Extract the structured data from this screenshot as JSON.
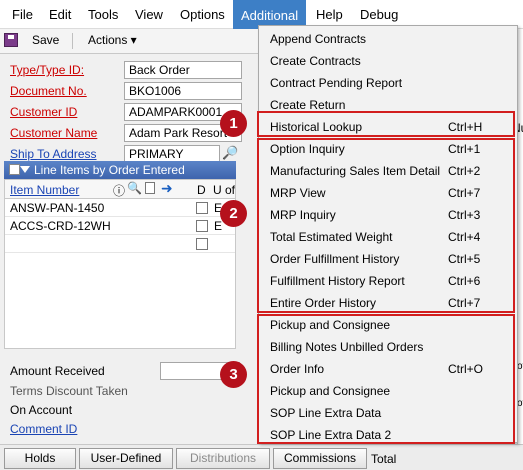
{
  "menubar": [
    "File",
    "Edit",
    "Tools",
    "View",
    "Options",
    "Additional",
    "Help",
    "Debug"
  ],
  "toolbar": {
    "save_label": "Save",
    "actions_label": "Actions ▾"
  },
  "form": {
    "fields": [
      {
        "label": "Type/Type ID:",
        "value": "Back Order"
      },
      {
        "label": "Document No.",
        "value": "BKO1006"
      },
      {
        "label": "Customer ID",
        "value": "ADAMPARK0001"
      },
      {
        "label": "Customer Name",
        "value": "Adam Park Resort"
      },
      {
        "label": "Ship To Address",
        "value": "PRIMARY"
      }
    ]
  },
  "line_items": {
    "header": "Line Items by Order Entered",
    "col_item": "Item Number",
    "col_d": "D",
    "col_u": "U of",
    "rows": [
      {
        "item": "ANSW-PAN-1450",
        "u": "E"
      },
      {
        "item": "ACCS-CRD-12WH",
        "u": "E"
      },
      {
        "item": "",
        "u": ""
      }
    ]
  },
  "bottom_fields": [
    "Amount Received",
    "Terms Discount Taken",
    "On Account",
    "Comment ID"
  ],
  "tabs": [
    "Holds",
    "User-Defined",
    "Distributions",
    "Commissions"
  ],
  "tab_extra": "Total",
  "dropdown": {
    "items": [
      {
        "label": "Append Contracts",
        "shortcut": ""
      },
      {
        "label": "Create Contracts",
        "shortcut": ""
      },
      {
        "label": "Contract Pending Report",
        "shortcut": ""
      },
      {
        "label": "Create Return",
        "shortcut": ""
      },
      {
        "label": "Historical Lookup",
        "shortcut": "Ctrl+H"
      },
      {
        "label": "Option Inquiry",
        "shortcut": "Ctrl+1"
      },
      {
        "label": "Manufacturing Sales Item Detail",
        "shortcut": "Ctrl+2"
      },
      {
        "label": "MRP View",
        "shortcut": "Ctrl+7"
      },
      {
        "label": "MRP Inquiry",
        "shortcut": "Ctrl+3"
      },
      {
        "label": "Total Estimated Weight",
        "shortcut": "Ctrl+4"
      },
      {
        "label": "Order Fulfillment History",
        "shortcut": "Ctrl+5"
      },
      {
        "label": "Fulfillment History Report",
        "shortcut": "Ctrl+6"
      },
      {
        "label": "Entire Order History",
        "shortcut": "Ctrl+7"
      },
      {
        "label": "Pickup and Consignee",
        "shortcut": ""
      },
      {
        "label": "Billing Notes Unbilled Orders",
        "shortcut": ""
      },
      {
        "label": "Order Info",
        "shortcut": "Ctrl+O"
      },
      {
        "label": "Pickup and Consignee",
        "shortcut": ""
      },
      {
        "label": "SOP Line Extra Data",
        "shortcut": ""
      },
      {
        "label": "SOP Line Extra Data 2",
        "shortcut": ""
      }
    ]
  },
  "callouts": [
    "1",
    "2",
    "3"
  ],
  "right_peek": [
    "Nu",
    "Tota",
    "Tot"
  ],
  "colors": {
    "accent": "#3d7fc6",
    "callout": "#b5111c",
    "highlight_box": "#d21e1e"
  }
}
